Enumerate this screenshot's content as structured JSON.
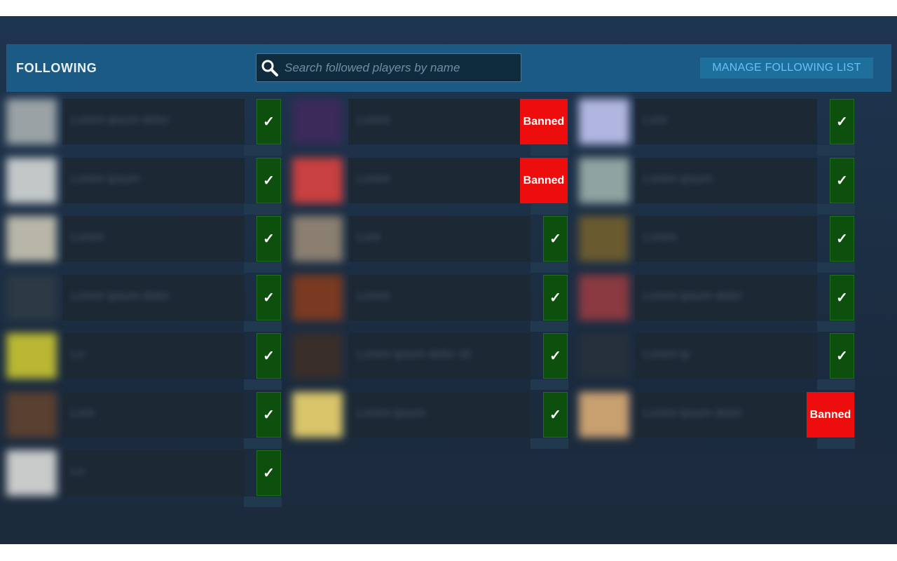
{
  "header": {
    "title": "FOLLOWING",
    "search_placeholder": "Search followed players by name",
    "manage_label": "MANAGE FOLLOWING LIST"
  },
  "colors": {
    "header_bg": "#1a5a84",
    "ok_bg": "#0d4f0d",
    "banned_bg": "#ee0d0d",
    "link": "#66c0f4"
  },
  "columns": [
    {
      "players": [
        {
          "status": "ok",
          "status_label": "✓",
          "avatar_color": "#9aa2a5",
          "blurred_name": "Lorem ipsum dolor"
        },
        {
          "status": "ok",
          "status_label": "✓",
          "avatar_color": "#c2c7c8",
          "blurred_name": "Lorem ipsum"
        },
        {
          "status": "ok",
          "status_label": "✓",
          "avatar_color": "#b8b6a8",
          "blurred_name": "Lorem"
        },
        {
          "status": "ok",
          "status_label": "✓",
          "avatar_color": "#2c3a44",
          "blurred_name": "Lorem ipsum dolor"
        },
        {
          "status": "ok",
          "status_label": "✓",
          "avatar_color": "#b9b733",
          "blurred_name": "Lo"
        },
        {
          "status": "ok",
          "status_label": "✓",
          "avatar_color": "#5a4030",
          "blurred_name": "Lore"
        },
        {
          "status": "ok",
          "status_label": "✓",
          "avatar_color": "#c9cbcb",
          "blurred_name": "Lo"
        }
      ]
    },
    {
      "players": [
        {
          "status": "banned",
          "status_label": "Banned",
          "avatar_color": "#3b2a5a",
          "blurred_name": "Lorem"
        },
        {
          "status": "banned",
          "status_label": "Banned",
          "avatar_color": "#c94040",
          "blurred_name": "Lorem"
        },
        {
          "status": "ok",
          "status_label": "✓",
          "avatar_color": "#8a7f70",
          "blurred_name": "Lore"
        },
        {
          "status": "ok",
          "status_label": "✓",
          "avatar_color": "#7a3a22",
          "blurred_name": "Lorem"
        },
        {
          "status": "ok",
          "status_label": "✓",
          "avatar_color": "#3a2e2a",
          "blurred_name": "Lorem ipsum dolor sit"
        },
        {
          "status": "ok",
          "status_label": "✓",
          "avatar_color": "#d9c56a",
          "blurred_name": "Lorem ipsum"
        }
      ]
    },
    {
      "players": [
        {
          "status": "ok",
          "status_label": "✓",
          "avatar_color": "#b0b6e0",
          "blurred_name": "Lore"
        },
        {
          "status": "ok",
          "status_label": "✓",
          "avatar_color": "#8fa3a0",
          "blurred_name": "Lorem ipsum"
        },
        {
          "status": "ok",
          "status_label": "✓",
          "avatar_color": "#6a5a30",
          "blurred_name": "Lorem"
        },
        {
          "status": "ok",
          "status_label": "✓",
          "avatar_color": "#8a3a40",
          "blurred_name": "Lorem ipsum dolor"
        },
        {
          "status": "ok",
          "status_label": "✓",
          "avatar_color": "#25303a",
          "blurred_name": "Lorem ip"
        },
        {
          "status": "banned",
          "status_label": "Banned",
          "avatar_color": "#c9a070",
          "blurred_name": "Lorem ipsum dolor"
        }
      ]
    }
  ]
}
